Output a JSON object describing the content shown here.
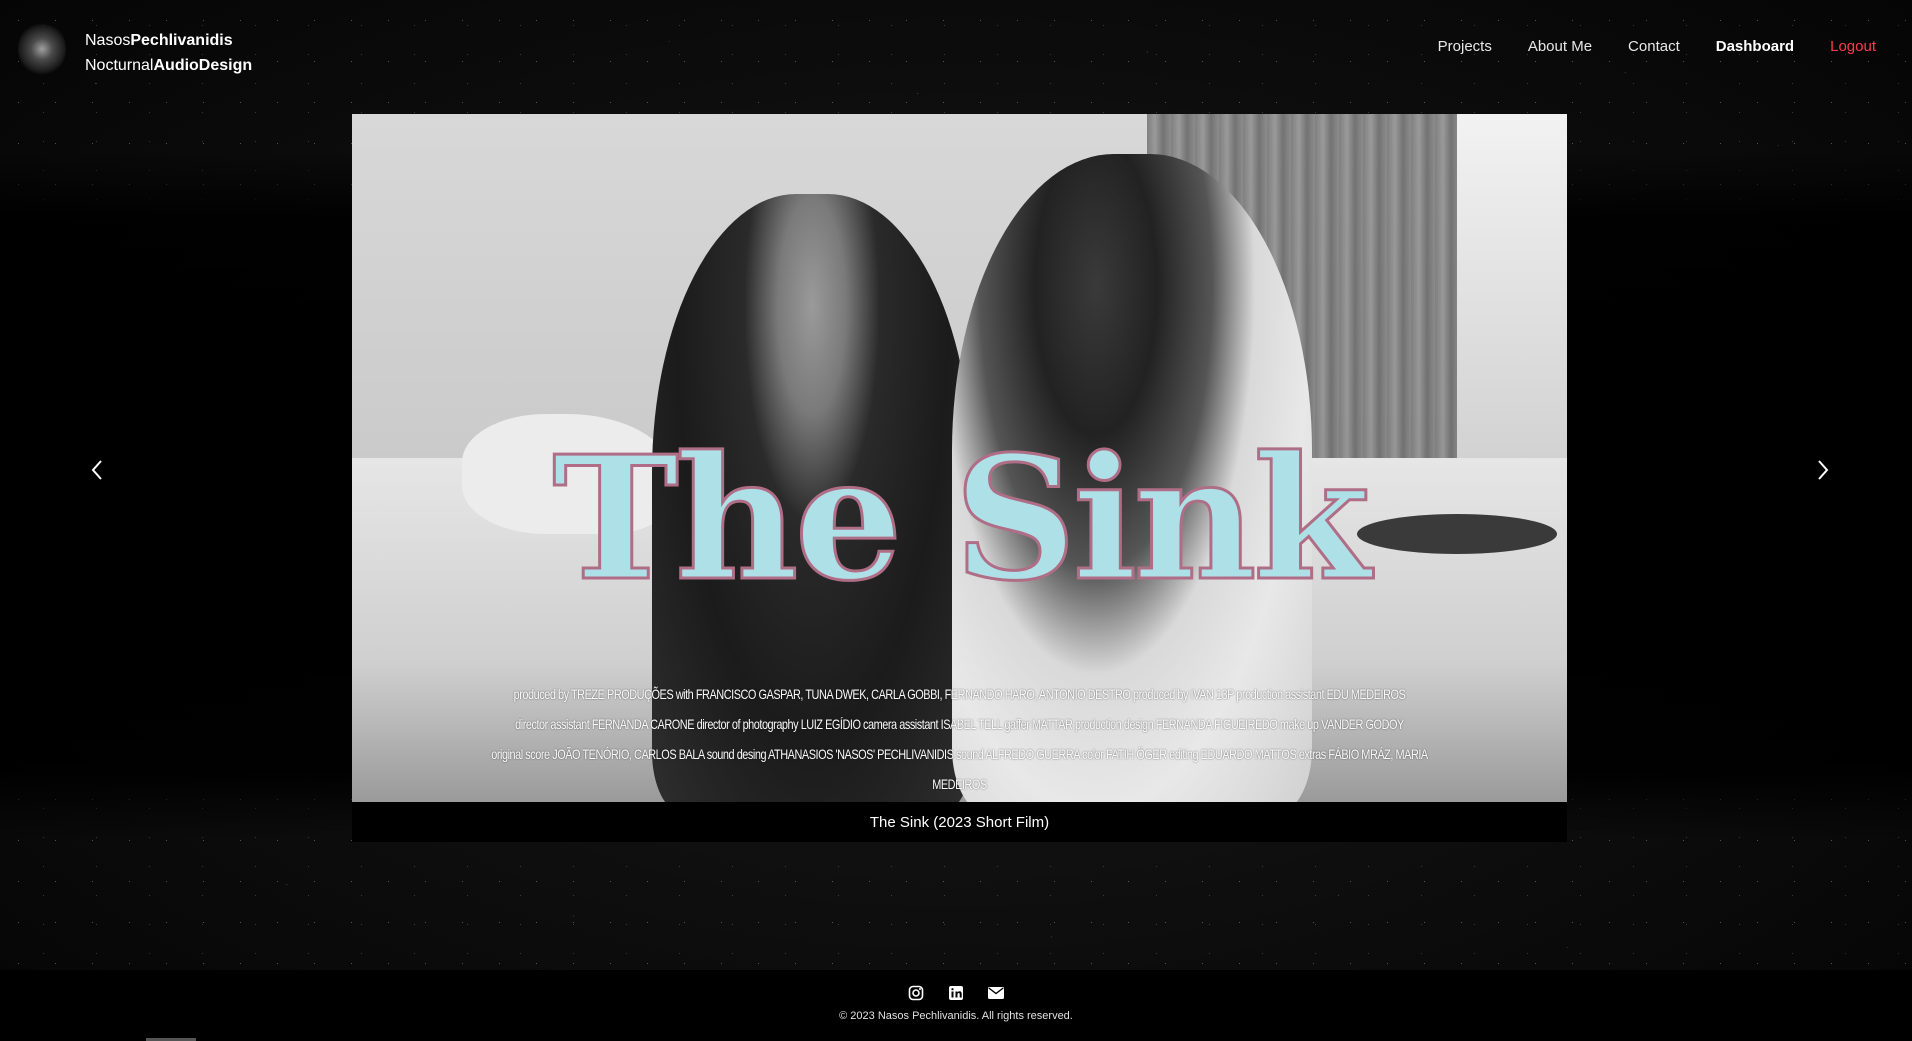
{
  "brand": {
    "first_name": "Nasos",
    "last_name": "Pechlivanidis",
    "line2_prefix": "Nocturnal",
    "line2_bold": "AudioDesign"
  },
  "nav": {
    "projects": "Projects",
    "about": "About Me",
    "contact": "Contact",
    "dashboard": "Dashboard",
    "logout": "Logout"
  },
  "slide": {
    "title": "The Sink",
    "credits_line1": "produced by TREZE PRODUÇÕES with FRANCISCO GASPAR, TUNA DWEK, CARLA GOBBI, FERNANDO HARO, ANTONIO DESTRO produced by IVAN 13P production assistant EDU MEDEIROS",
    "credits_line2": "director assistant FERNANDA CARONE director of photography LUIZ EGÍDIO camera assistant ISABEL TELL gaffer MATTAR production design FERNANDA FIGUEIREDO make up VANDER GODOY",
    "credits_line3": "original score JOÃO TENÓRIO, CARLOS BALA sound desing ATHANASIOS 'NASOS' PECHLIVANIDIS sound ALFREDO GUERRA color FATIH ÖGER editing EDUARDO MATTOS extras FÁBIO MRÁZ, MARIA MEDEIROS",
    "caption": "The Sink (2023 Short Film)"
  },
  "footer": {
    "copyright": "© 2023 Nasos Pechlivanidis. All rights reserved."
  },
  "colors": {
    "logout": "#ff3b4f",
    "title_fill": "#aee0e8",
    "title_outline": "#b06e86"
  }
}
